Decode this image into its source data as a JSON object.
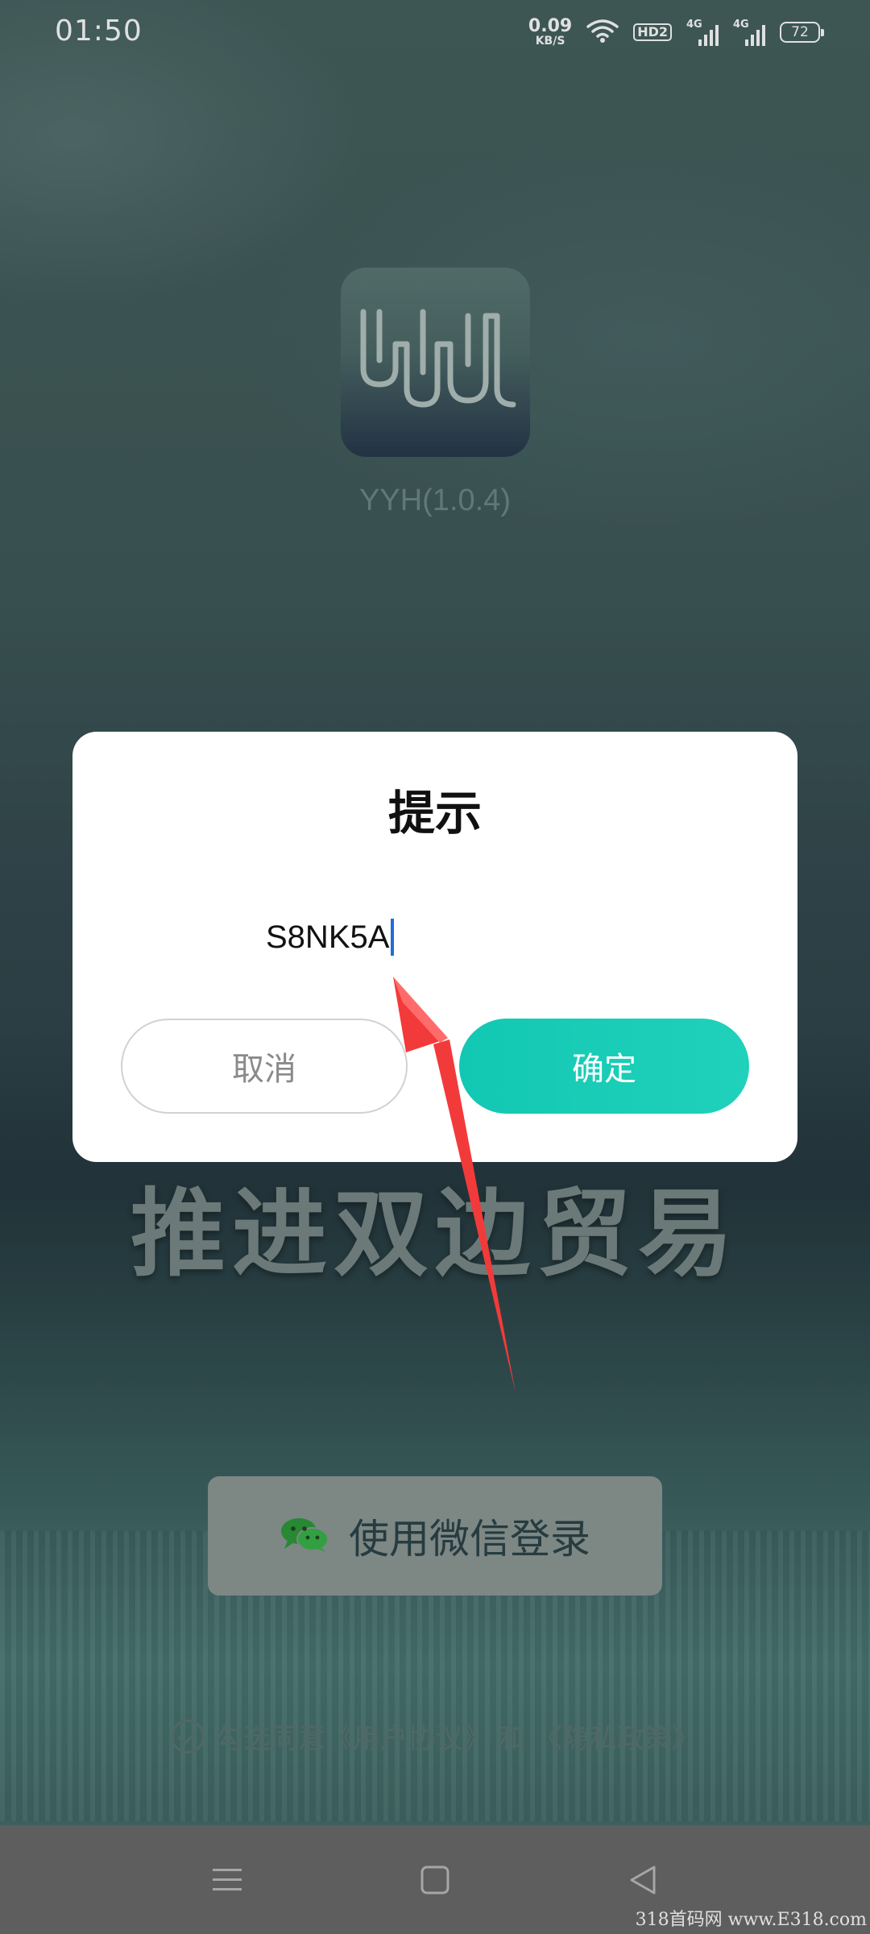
{
  "status_bar": {
    "time": "01:50",
    "net_speed_value": "0.09",
    "net_speed_unit": "KB/S",
    "hd_label": "HD2",
    "sim1_label": "4G",
    "sim2_label": "4G",
    "battery_level": "72",
    "icons": [
      "wifi-icon",
      "hd-icon",
      "signal-icon",
      "signal-icon",
      "battery-icon"
    ]
  },
  "app": {
    "logo_text": "YYH",
    "version_label": "YYH(1.0.4)"
  },
  "background": {
    "slogan": "推进双边贸易"
  },
  "dialog": {
    "title": "提示",
    "input_value": "S8NK5A",
    "cancel_label": "取消",
    "confirm_label": "确定",
    "confirm_color": "#14c9b4"
  },
  "login": {
    "wechat_label": "使用微信登录",
    "wechat_icon": "wechat-icon"
  },
  "agreement": {
    "text": "勾选同意《用户协议》 和 《隐私政策》"
  },
  "nav_bar": {
    "icons": [
      "menu-icon",
      "home-icon",
      "back-icon"
    ]
  },
  "watermark": {
    "text": "318首码网 www.E318.com"
  }
}
